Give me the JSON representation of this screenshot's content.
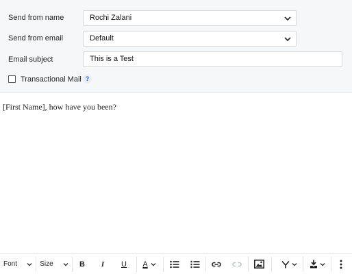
{
  "form": {
    "from_name_label": "Send from name",
    "from_name_value": "Rochi Zalani",
    "from_email_label": "Send from email",
    "from_email_value": "Default",
    "subject_label": "Email subject",
    "subject_value": "This is a Test",
    "transactional_label": "Transactional Mail",
    "transactional_checked": false,
    "help_glyph": "?"
  },
  "editor": {
    "body": "[First Name], how have you been?"
  },
  "toolbar": {
    "font_label": "Font",
    "size_label": "Size",
    "bold": "B",
    "italic": "I",
    "underline": "U",
    "text_color": "A",
    "icons": [
      "bold-icon",
      "italic-icon",
      "underline-icon",
      "text-color-icon",
      "bulleted-list-icon",
      "numbered-list-icon",
      "link-icon",
      "unlink-icon",
      "image-icon",
      "merge-field-icon",
      "insert-icon",
      "more-options-icon"
    ]
  },
  "colors": {
    "settings_bg": "#f6f7f8",
    "help_accent": "#2a6cd6",
    "disabled_icon": "#bfc3c7"
  }
}
